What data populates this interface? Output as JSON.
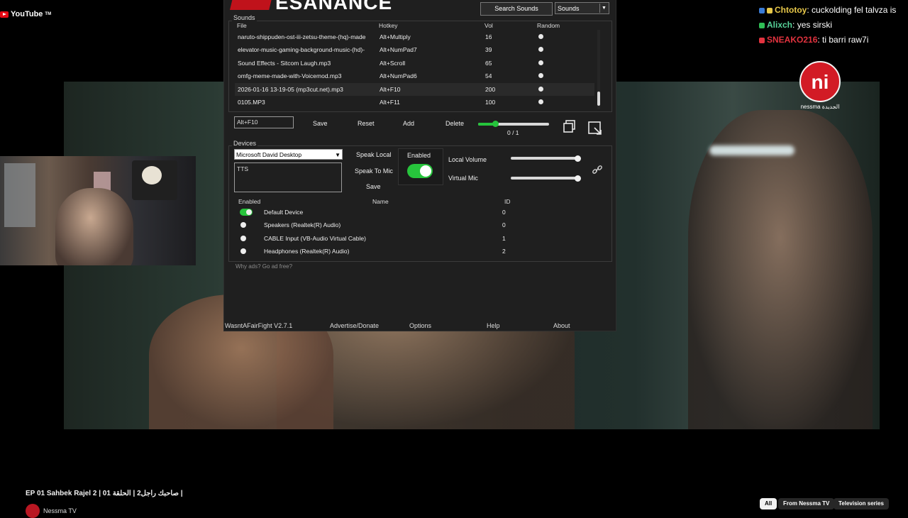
{
  "youtube": {
    "logo": "YouTube",
    "tm": "TM",
    "video_title": "EP 01 Sahbek Rajel 2 | صاحبك راجل2 | الحلقة 01 |",
    "channel": "Nessma TV",
    "chips": [
      "All",
      "From Nessma TV",
      "Television series"
    ]
  },
  "chat": [
    {
      "user": "Chtotoy",
      "user_color": "#e8c84a",
      "message": "cuckolding fel talvza is"
    },
    {
      "user": "Alixch",
      "user_color": "#58d39a",
      "message": "yes sirski"
    },
    {
      "user": "SNEAKO216",
      "user_color": "#e2333f",
      "message": "ti barri raw7i"
    }
  ],
  "nessma_logo": {
    "glyph": "ni",
    "caption": "nessma الجديدة"
  },
  "app": {
    "brand": "ESANANCE",
    "search_button": "Search Sounds",
    "mode_select": "Sounds",
    "sounds_group": "Sounds",
    "columns": {
      "file": "File",
      "hotkey": "Hotkey",
      "vol": "Vol",
      "random": "Random"
    },
    "sounds": [
      {
        "file": "naruto-shippuden-ost-iii-zetsu-theme-(hq)-made",
        "hotkey": "Alt+Multiply",
        "vol": "16"
      },
      {
        "file": "elevator-music-gaming-background-music-(hd)-",
        "hotkey": "Alt+NumPad7",
        "vol": "39"
      },
      {
        "file": "Sound Effects - Sitcom Laugh.mp3",
        "hotkey": "Alt+Scroll",
        "vol": "65"
      },
      {
        "file": "omfg-meme-made-with-Voicemod.mp3",
        "hotkey": "Alt+NumPad6",
        "vol": "54"
      },
      {
        "file": "2026-01-16 13-19-05 (mp3cut.net).mp3",
        "hotkey": "Alt+F10",
        "vol": "200"
      },
      {
        "file": "0105.MP3",
        "hotkey": "Alt+F11",
        "vol": "100"
      }
    ],
    "hotkey_value": "Alt+F10",
    "buttons": {
      "save": "Save",
      "reset": "Reset",
      "add": "Add",
      "delete": "Delete"
    },
    "slider_counter": "0 / 1",
    "devices_group": "Devices",
    "voice_select": "Microsoft David Desktop",
    "tts_text": "TTS",
    "speak_local": "Speak Local",
    "speak_to_mic": "Speak To Mic",
    "tts_save": "Save",
    "enabled_label": "Enabled",
    "local_volume_label": "Local Volume",
    "virtual_mic_label": "Virtual Mic",
    "local_volume_level": 0.98,
    "virtual_mic_level": 0.98,
    "device_columns": {
      "enabled": "Enabled",
      "name": "Name",
      "id": "ID"
    },
    "devices": [
      {
        "name": "Default Device",
        "id": "0",
        "enabled": true
      },
      {
        "name": "Speakers (Realtek(R) Audio)",
        "id": "0",
        "enabled": false
      },
      {
        "name": "CABLE Input (VB-Audio Virtual Cable)",
        "id": "1",
        "enabled": false
      },
      {
        "name": "Headphones (Realtek(R) Audio)",
        "id": "2",
        "enabled": false
      }
    ],
    "ad_text": "Why ads? Go ad free?",
    "footer": {
      "version": "WasntAFairFight V2.7.1",
      "advertise": "Advertise/Donate",
      "options": "Options",
      "help": "Help",
      "about": "About"
    }
  }
}
